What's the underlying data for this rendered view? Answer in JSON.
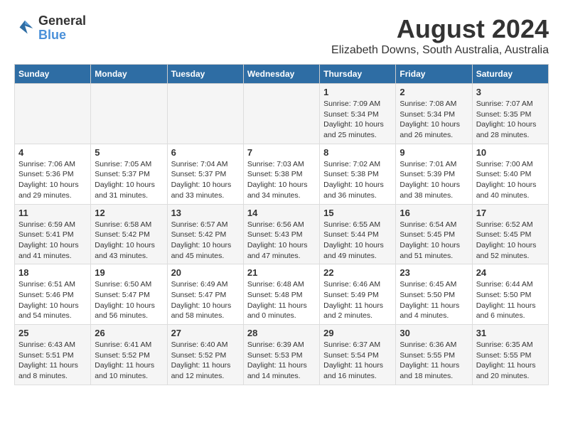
{
  "logo": {
    "line1": "General",
    "line2": "Blue"
  },
  "title": "August 2024",
  "subtitle": "Elizabeth Downs, South Australia, Australia",
  "headers": [
    "Sunday",
    "Monday",
    "Tuesday",
    "Wednesday",
    "Thursday",
    "Friday",
    "Saturday"
  ],
  "weeks": [
    [
      {
        "day": "",
        "info": ""
      },
      {
        "day": "",
        "info": ""
      },
      {
        "day": "",
        "info": ""
      },
      {
        "day": "",
        "info": ""
      },
      {
        "day": "1",
        "info": "Sunrise: 7:09 AM\nSunset: 5:34 PM\nDaylight: 10 hours\nand 25 minutes."
      },
      {
        "day": "2",
        "info": "Sunrise: 7:08 AM\nSunset: 5:34 PM\nDaylight: 10 hours\nand 26 minutes."
      },
      {
        "day": "3",
        "info": "Sunrise: 7:07 AM\nSunset: 5:35 PM\nDaylight: 10 hours\nand 28 minutes."
      }
    ],
    [
      {
        "day": "4",
        "info": "Sunrise: 7:06 AM\nSunset: 5:36 PM\nDaylight: 10 hours\nand 29 minutes."
      },
      {
        "day": "5",
        "info": "Sunrise: 7:05 AM\nSunset: 5:37 PM\nDaylight: 10 hours\nand 31 minutes."
      },
      {
        "day": "6",
        "info": "Sunrise: 7:04 AM\nSunset: 5:37 PM\nDaylight: 10 hours\nand 33 minutes."
      },
      {
        "day": "7",
        "info": "Sunrise: 7:03 AM\nSunset: 5:38 PM\nDaylight: 10 hours\nand 34 minutes."
      },
      {
        "day": "8",
        "info": "Sunrise: 7:02 AM\nSunset: 5:38 PM\nDaylight: 10 hours\nand 36 minutes."
      },
      {
        "day": "9",
        "info": "Sunrise: 7:01 AM\nSunset: 5:39 PM\nDaylight: 10 hours\nand 38 minutes."
      },
      {
        "day": "10",
        "info": "Sunrise: 7:00 AM\nSunset: 5:40 PM\nDaylight: 10 hours\nand 40 minutes."
      }
    ],
    [
      {
        "day": "11",
        "info": "Sunrise: 6:59 AM\nSunset: 5:41 PM\nDaylight: 10 hours\nand 41 minutes."
      },
      {
        "day": "12",
        "info": "Sunrise: 6:58 AM\nSunset: 5:42 PM\nDaylight: 10 hours\nand 43 minutes."
      },
      {
        "day": "13",
        "info": "Sunrise: 6:57 AM\nSunset: 5:42 PM\nDaylight: 10 hours\nand 45 minutes."
      },
      {
        "day": "14",
        "info": "Sunrise: 6:56 AM\nSunset: 5:43 PM\nDaylight: 10 hours\nand 47 minutes."
      },
      {
        "day": "15",
        "info": "Sunrise: 6:55 AM\nSunset: 5:44 PM\nDaylight: 10 hours\nand 49 minutes."
      },
      {
        "day": "16",
        "info": "Sunrise: 6:54 AM\nSunset: 5:45 PM\nDaylight: 10 hours\nand 51 minutes."
      },
      {
        "day": "17",
        "info": "Sunrise: 6:52 AM\nSunset: 5:45 PM\nDaylight: 10 hours\nand 52 minutes."
      }
    ],
    [
      {
        "day": "18",
        "info": "Sunrise: 6:51 AM\nSunset: 5:46 PM\nDaylight: 10 hours\nand 54 minutes."
      },
      {
        "day": "19",
        "info": "Sunrise: 6:50 AM\nSunset: 5:47 PM\nDaylight: 10 hours\nand 56 minutes."
      },
      {
        "day": "20",
        "info": "Sunrise: 6:49 AM\nSunset: 5:47 PM\nDaylight: 10 hours\nand 58 minutes."
      },
      {
        "day": "21",
        "info": "Sunrise: 6:48 AM\nSunset: 5:48 PM\nDaylight: 11 hours\nand 0 minutes."
      },
      {
        "day": "22",
        "info": "Sunrise: 6:46 AM\nSunset: 5:49 PM\nDaylight: 11 hours\nand 2 minutes."
      },
      {
        "day": "23",
        "info": "Sunrise: 6:45 AM\nSunset: 5:50 PM\nDaylight: 11 hours\nand 4 minutes."
      },
      {
        "day": "24",
        "info": "Sunrise: 6:44 AM\nSunset: 5:50 PM\nDaylight: 11 hours\nand 6 minutes."
      }
    ],
    [
      {
        "day": "25",
        "info": "Sunrise: 6:43 AM\nSunset: 5:51 PM\nDaylight: 11 hours\nand 8 minutes."
      },
      {
        "day": "26",
        "info": "Sunrise: 6:41 AM\nSunset: 5:52 PM\nDaylight: 11 hours\nand 10 minutes."
      },
      {
        "day": "27",
        "info": "Sunrise: 6:40 AM\nSunset: 5:52 PM\nDaylight: 11 hours\nand 12 minutes."
      },
      {
        "day": "28",
        "info": "Sunrise: 6:39 AM\nSunset: 5:53 PM\nDaylight: 11 hours\nand 14 minutes."
      },
      {
        "day": "29",
        "info": "Sunrise: 6:37 AM\nSunset: 5:54 PM\nDaylight: 11 hours\nand 16 minutes."
      },
      {
        "day": "30",
        "info": "Sunrise: 6:36 AM\nSunset: 5:55 PM\nDaylight: 11 hours\nand 18 minutes."
      },
      {
        "day": "31",
        "info": "Sunrise: 6:35 AM\nSunset: 5:55 PM\nDaylight: 11 hours\nand 20 minutes."
      }
    ]
  ]
}
